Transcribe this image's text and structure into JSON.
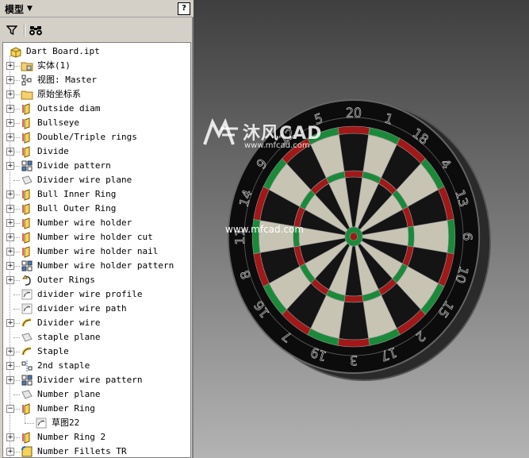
{
  "panel": {
    "title": "模型",
    "help_label": "?"
  },
  "tree": {
    "items": [
      {
        "label": "Dart Board.ipt",
        "icon": "part-icon",
        "expander": ""
      },
      {
        "label": "实体(1)",
        "icon": "solid-bodies-folder-icon",
        "expander": "+"
      },
      {
        "label": "视图: Master",
        "icon": "view-rep-icon",
        "expander": "+"
      },
      {
        "label": "原始坐标系",
        "icon": "origin-folder-icon",
        "expander": "+"
      },
      {
        "label": "Outside diam",
        "icon": "extrude-icon",
        "expander": "+"
      },
      {
        "label": "Bullseye",
        "icon": "extrude-icon",
        "expander": "+"
      },
      {
        "label": "Double/Triple rings",
        "icon": "extrude-icon",
        "expander": "+"
      },
      {
        "label": "Divide",
        "icon": "extrude-icon",
        "expander": "+"
      },
      {
        "label": "Divide pattern",
        "icon": "pattern-icon",
        "expander": "+"
      },
      {
        "label": "Divider wire plane",
        "icon": "work-plane-icon",
        "expander": ""
      },
      {
        "label": "Bull Inner Ring",
        "icon": "extrude-icon",
        "expander": "+"
      },
      {
        "label": "Bull Outer Ring",
        "icon": "extrude-icon",
        "expander": "+"
      },
      {
        "label": "Number wire holder",
        "icon": "extrude-icon",
        "expander": "+"
      },
      {
        "label": "Number wire holder cut",
        "icon": "extrude-icon",
        "expander": "+"
      },
      {
        "label": "Number wire holder nail",
        "icon": "extrude-icon",
        "expander": "+"
      },
      {
        "label": "Number wire holder pattern",
        "icon": "pattern-icon",
        "expander": "+"
      },
      {
        "label": "Outer Rings",
        "icon": "revolve-icon",
        "expander": "+"
      },
      {
        "label": "divider wire profile",
        "icon": "sketch-icon",
        "expander": ""
      },
      {
        "label": "divider wire path",
        "icon": "sketch-icon",
        "expander": ""
      },
      {
        "label": "Divider wire",
        "icon": "sweep-icon",
        "expander": "+"
      },
      {
        "label": "staple plane",
        "icon": "work-plane-icon",
        "expander": ""
      },
      {
        "label": "Staple",
        "icon": "sweep-icon",
        "expander": "+"
      },
      {
        "label": "2nd staple",
        "icon": "mirror-icon",
        "expander": "+"
      },
      {
        "label": "Divider wire pattern",
        "icon": "pattern-icon",
        "expander": "+"
      },
      {
        "label": "Number plane",
        "icon": "work-plane-icon",
        "expander": ""
      },
      {
        "label": "Number Ring",
        "icon": "extrude-icon",
        "expander": "−"
      },
      {
        "label": "草图22",
        "icon": "sketch-icon",
        "expander": "",
        "child": true
      },
      {
        "label": "Number Ring 2",
        "icon": "extrude-icon",
        "expander": "+"
      },
      {
        "label": "Number Fillets TR",
        "icon": "fillet-icon",
        "expander": "+"
      }
    ]
  },
  "viewport": {
    "watermark_brand": "沐风CAD",
    "watermark_url": "www.mfcad.com",
    "watermark_url2": "www.mfcad.com",
    "board_numbers": [
      "20",
      "1",
      "18",
      "4",
      "13",
      "6",
      "10",
      "15",
      "2",
      "17",
      "3",
      "19",
      "7",
      "16",
      "8",
      "11",
      "14",
      "9",
      "12",
      "5"
    ]
  },
  "colors": {
    "panel_bg": "#d4d0c8",
    "ring_red": "#a01818",
    "ring_green": "#1a8a3a",
    "segment_light": "#c8c4b4",
    "segment_dark": "#141414"
  }
}
